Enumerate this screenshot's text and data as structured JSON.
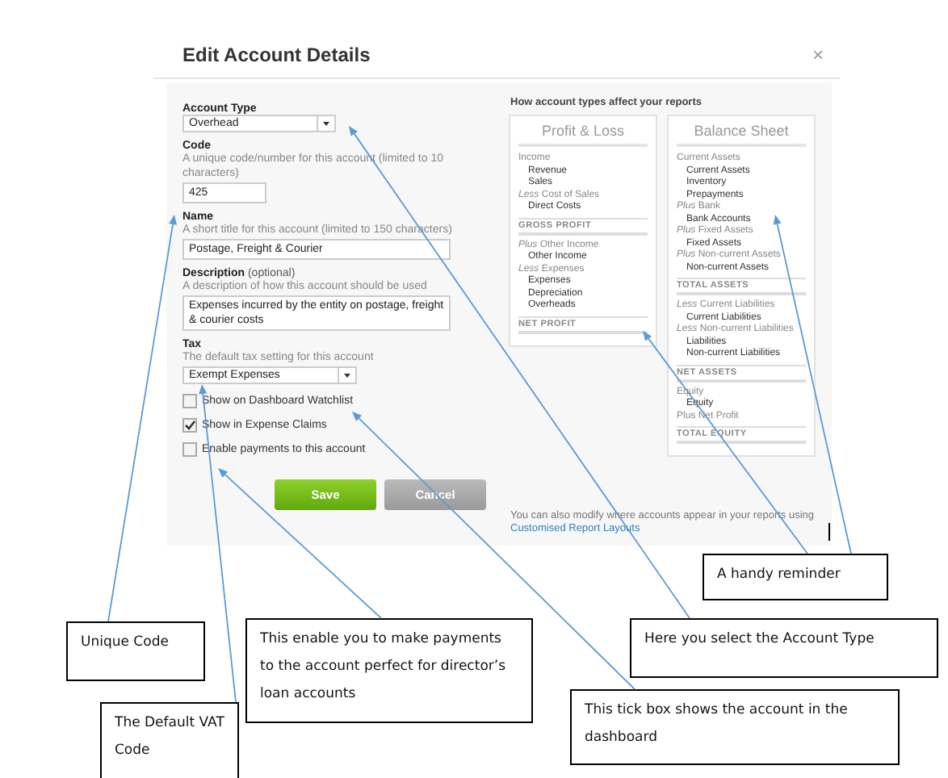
{
  "dialog": {
    "title": "Edit Account Details",
    "close": "×"
  },
  "form": {
    "account_type": {
      "label": "Account Type",
      "value": "Overhead"
    },
    "code": {
      "label": "Code",
      "hint": "A unique code/number for this account (limited to 10 characters)",
      "value": "425"
    },
    "name": {
      "label": "Name",
      "hint": "A short title for this account (limited to 150 characters)",
      "value": "Postage, Freight & Courier"
    },
    "description": {
      "label": "Description",
      "optional": "(optional)",
      "hint": "A description of how this account should be used",
      "value": "Expenses incurred by the entity on postage, freight & courier costs"
    },
    "tax": {
      "label": "Tax",
      "hint": "The default tax setting for this account",
      "value": "Exempt Expenses"
    },
    "checkboxes": [
      {
        "label": "Show on Dashboard Watchlist",
        "checked": false
      },
      {
        "label": "Show in Expense Claims",
        "checked": true
      },
      {
        "label": "Enable payments to this account",
        "checked": false
      }
    ],
    "buttons": [
      {
        "label": "Save",
        "kind": "primary"
      },
      {
        "label": "Cancel",
        "kind": "secondary"
      }
    ]
  },
  "report_guide": {
    "heading": "How account types affect your reports",
    "cards": [
      {
        "title": "Profit & Loss",
        "sections": [
          {
            "kind": "group",
            "label": "Income",
            "items": [
              "Revenue",
              "Sales"
            ]
          },
          {
            "kind": "group",
            "label": "*Less* Cost of Sales",
            "items": [
              "Direct Costs"
            ]
          },
          {
            "kind": "total",
            "label": "GROSS PROFIT"
          },
          {
            "kind": "group",
            "label": "*Plus* Other Income",
            "items": [
              "Other Income"
            ]
          },
          {
            "kind": "group",
            "label": "*Less* Expenses",
            "items": [
              "Expenses",
              "Depreciation",
              "Overheads"
            ]
          },
          {
            "kind": "total",
            "label": "NET PROFIT"
          }
        ]
      },
      {
        "title": "Balance Sheet",
        "sections": [
          {
            "kind": "group",
            "label": "Current Assets",
            "items": [
              "Current Assets",
              "Inventory",
              "Prepayments"
            ]
          },
          {
            "kind": "group",
            "label": "*Plus* Bank",
            "items": [
              "Bank Accounts"
            ]
          },
          {
            "kind": "group",
            "label": "*Plus* Fixed Assets",
            "items": [
              "Fixed Assets"
            ]
          },
          {
            "kind": "group",
            "label": "*Plus* Non-current Assets",
            "items": [
              "Non-current Assets"
            ]
          },
          {
            "kind": "total",
            "label": "TOTAL ASSETS"
          },
          {
            "kind": "group",
            "label": "*Less* Current Liabilities",
            "items": [
              "Current Liabilities"
            ]
          },
          {
            "kind": "group",
            "label": "*Less* Non-current Liabilities",
            "items": [
              "Liabilities",
              "Non-current Liabilities"
            ]
          },
          {
            "kind": "total",
            "label": "NET ASSETS"
          },
          {
            "kind": "group",
            "label": "Equity",
            "items": [
              "Equity"
            ]
          },
          {
            "kind": "group",
            "label": "Plus Net Profit"
          },
          {
            "kind": "total",
            "label": "TOTAL EQUITY"
          }
        ]
      }
    ],
    "footnote": "You can also modify where accounts appear in your reports using",
    "link": "Customised Report Layouts"
  },
  "annotations": [
    {
      "text": "A handy reminder"
    },
    {
      "text": "Unique Code"
    },
    {
      "text": "This enable you to make payments to the account perfect for director’s loan accounts"
    },
    {
      "text": "Here you select the Account Type"
    },
    {
      "text": "The Default VAT Code"
    },
    {
      "text": "This tick box shows the account in the dashboard"
    }
  ]
}
